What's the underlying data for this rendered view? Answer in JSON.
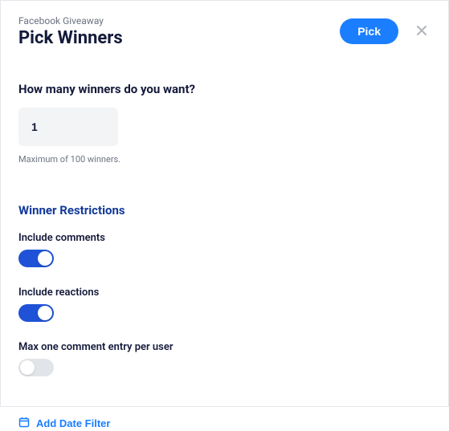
{
  "header": {
    "subtitle": "Facebook Giveaway",
    "title": "Pick Winners",
    "pick_label": "Pick"
  },
  "winners": {
    "question": "How many winners do you want?",
    "value": "1",
    "helper": "Maximum of 100 winners."
  },
  "restrictions": {
    "title": "Winner Restrictions",
    "include_comments": {
      "label": "Include comments",
      "on": true
    },
    "include_reactions": {
      "label": "Include reactions",
      "on": true
    },
    "max_one": {
      "label": "Max one comment entry per user",
      "on": false
    }
  },
  "add_filter_label": "Add Date Filter"
}
